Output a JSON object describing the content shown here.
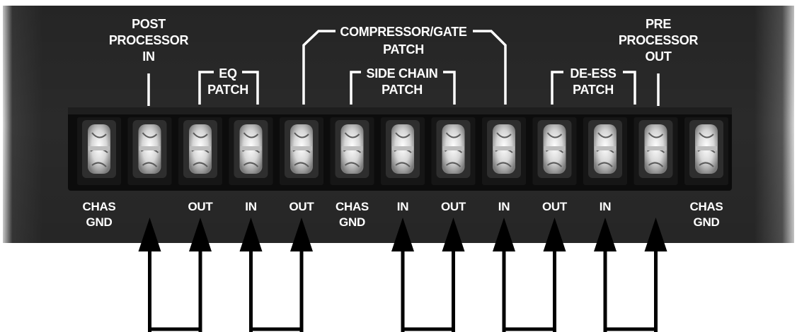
{
  "top_labels": {
    "post_processor_in": [
      "POST",
      "PROCESSOR",
      "IN"
    ],
    "eq_patch": [
      "EQ",
      "PATCH"
    ],
    "compressor_gate_patch": [
      "COMPRESSOR/GATE",
      "PATCH"
    ],
    "side_chain_patch": [
      "SIDE  CHAIN",
      "PATCH"
    ],
    "de_ess_patch": [
      "DE-ESS",
      "PATCH"
    ],
    "pre_processor_out": [
      "PRE",
      "PROCESSOR",
      "OUT"
    ]
  },
  "terminals": [
    {
      "label": [
        "CHAS",
        "GND"
      ]
    },
    {
      "label": []
    },
    {
      "label": [
        "OUT"
      ]
    },
    {
      "label": [
        "IN"
      ]
    },
    {
      "label": [
        "OUT"
      ]
    },
    {
      "label": [
        "CHAS",
        "GND"
      ]
    },
    {
      "label": [
        "IN"
      ]
    },
    {
      "label": [
        "OUT"
      ]
    },
    {
      "label": [
        "IN"
      ]
    },
    {
      "label": [
        "OUT"
      ]
    },
    {
      "label": [
        "IN"
      ]
    },
    {
      "label": []
    },
    {
      "label": [
        "CHAS",
        "GND"
      ]
    }
  ],
  "arrow_terminals": [
    1,
    2,
    3,
    4,
    6,
    7,
    8,
    9,
    10,
    11
  ],
  "jumpers": [
    [
      1,
      2
    ],
    [
      3,
      4
    ],
    [
      6,
      7
    ],
    [
      8,
      9
    ],
    [
      10,
      11
    ]
  ],
  "colors": {
    "panel": "#2b2b2b",
    "strip": "#0d0d0d",
    "screw": "#e8e8e8",
    "text": "#ffffff",
    "wire": "#000000"
  }
}
